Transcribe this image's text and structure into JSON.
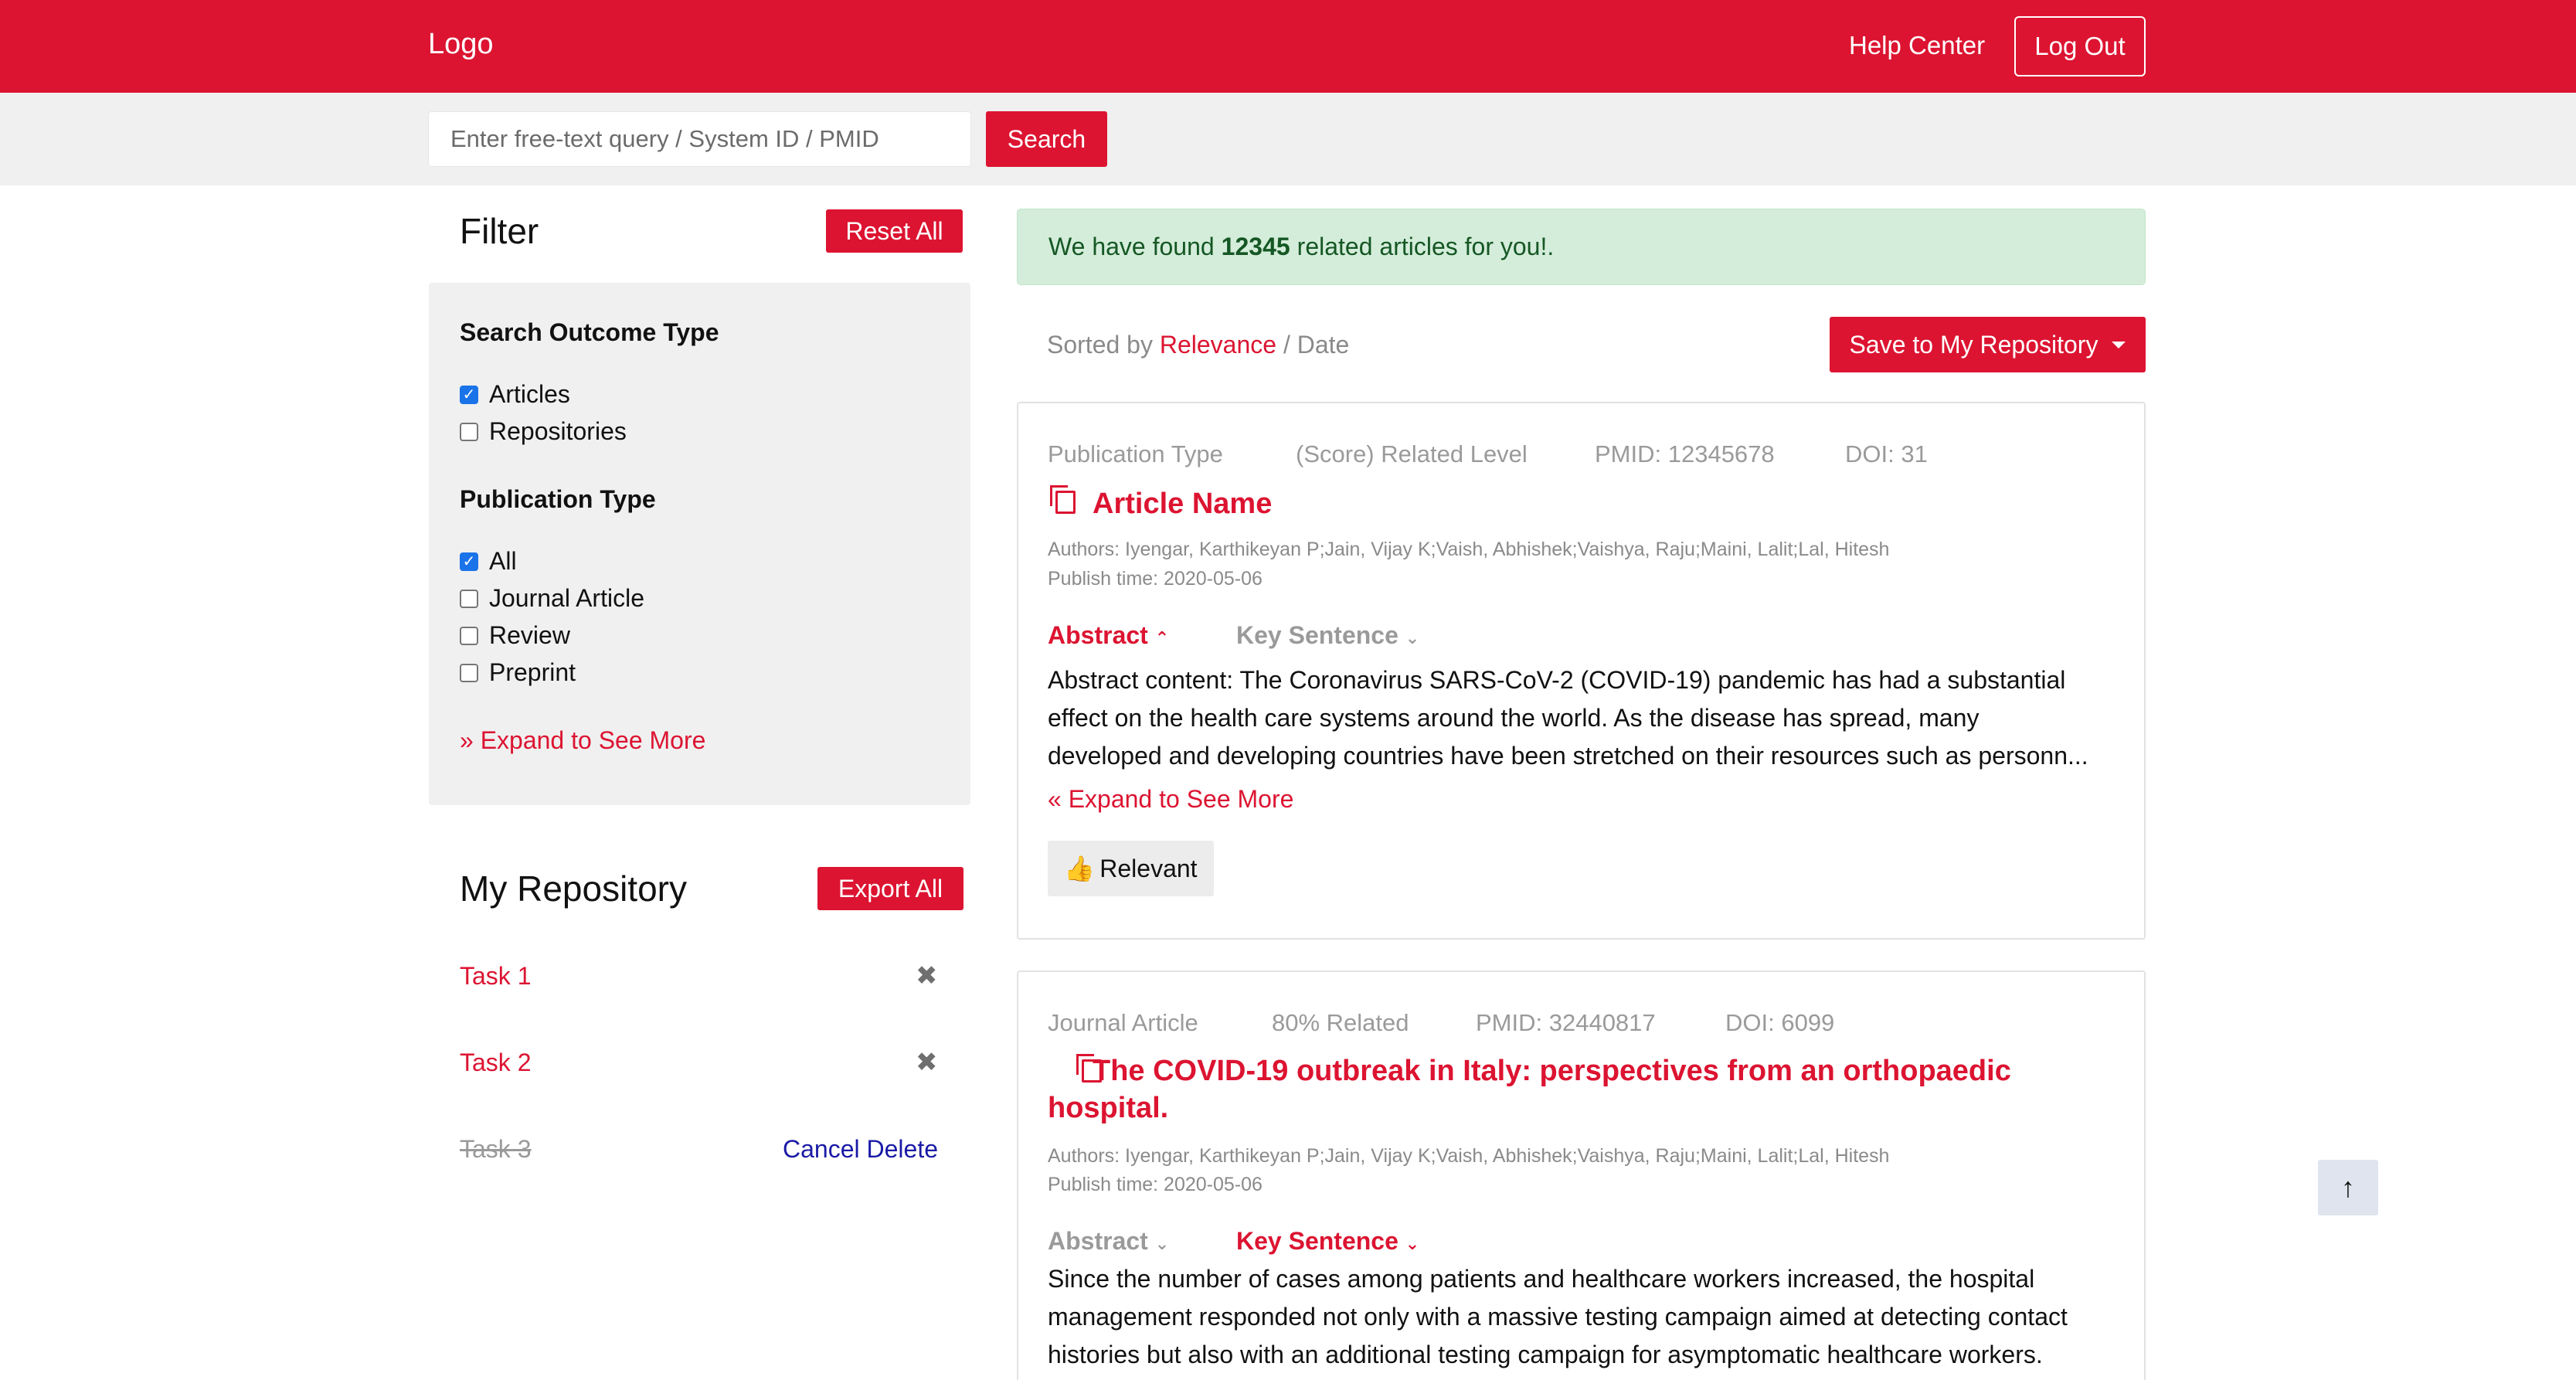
{
  "header": {
    "logo": "Logo",
    "help_center": "Help Center",
    "log_out": "Log Out"
  },
  "search": {
    "placeholder": "Enter free-text query / System ID / PMID",
    "button": "Search"
  },
  "filter": {
    "title": "Filter",
    "reset_all": "Reset All",
    "outcome_heading": "Search Outcome Type",
    "outcome_options": [
      {
        "label": "Articles",
        "checked": true
      },
      {
        "label": "Repositories",
        "checked": false
      }
    ],
    "pubtype_heading": "Publication Type",
    "pubtype_options": [
      {
        "label": "All",
        "checked": true
      },
      {
        "label": "Journal Article",
        "checked": false
      },
      {
        "label": "Review",
        "checked": false
      },
      {
        "label": "Preprint",
        "checked": false
      }
    ],
    "expand": "Expand to See More"
  },
  "repository": {
    "title": "My Repository",
    "export_all": "Export All",
    "tasks": [
      {
        "name": "Task 1",
        "deleted": false
      },
      {
        "name": "Task 2",
        "deleted": false
      },
      {
        "name": "Task 3",
        "deleted": true
      }
    ],
    "cancel_delete": "Cancel Delete"
  },
  "results": {
    "alert_prefix": "We have found",
    "count": "12345",
    "alert_suffix": "related articles for you!.",
    "sorted_by": "Sorted by",
    "sort_relevance": "Relevance",
    "sort_sep": " / ",
    "sort_date": "Date",
    "save_button": "Save to My Repository"
  },
  "articles": [
    {
      "pub_type": "Publication Type",
      "related": "(Score) Related Level",
      "pmid": "PMID: 12345678",
      "doi": "DOI: 31",
      "title": "Article Name",
      "authors": "Authors: Iyengar, Karthikeyan P;Jain, Vijay K;Vaish, Abhishek;Vaishya, Raju;Maini, Lalit;Lal, Hitesh",
      "publish_time": "Publish time: 2020-05-06",
      "tab_abstract": "Abstract",
      "tab_key": "Key Sentence",
      "active_tab": "abstract",
      "abstract_lines": [
        "Abstract content: The Coronavirus SARS-CoV-2 (COVID-19) pandemic has had a substantial",
        "effect on the health care systems around the world. As the disease has spread, many",
        "developed and developing countries have been stretched on their resources such as personn..."
      ],
      "expand": "Expand to See More",
      "relevant": "Relevant"
    },
    {
      "pub_type": "Journal Article",
      "related": "80% Related",
      "pmid": "PMID: 32440817",
      "doi": "DOI: 6099",
      "title_lines": [
        "The COVID-19 outbreak in Italy: perspectives from an orthopaedic",
        "hospital."
      ],
      "authors": "Authors: Iyengar, Karthikeyan P;Jain, Vijay K;Vaish, Abhishek;Vaishya, Raju;Maini, Lalit;Lal, Hitesh",
      "publish_time": "Publish time: 2020-05-06",
      "tab_abstract": "Abstract",
      "tab_key": "Key Sentence",
      "active_tab": "key_sentence",
      "key_lines": [
        "Since the number of cases among patients and healthcare workers increased, the hospital",
        "management responded not only with a massive testing campaign aimed at detecting contact",
        "histories but also with an additional testing campaign for asymptomatic healthcare workers."
      ]
    }
  ],
  "colors": {
    "brand_red": "#dc1431",
    "alert_green_bg": "#d4edda",
    "link_blue": "#1a1aa6"
  },
  "icons": {
    "copy": "copy-icon",
    "close": "close-icon",
    "chevron_up": "chevron-up-icon",
    "chevron_down": "chevron-down-icon",
    "double_chevron": "double-chevron-icon",
    "thumbs_up": "thumbs-up-icon",
    "arrow_up": "arrow-up-icon",
    "caret_down": "caret-down-icon"
  }
}
